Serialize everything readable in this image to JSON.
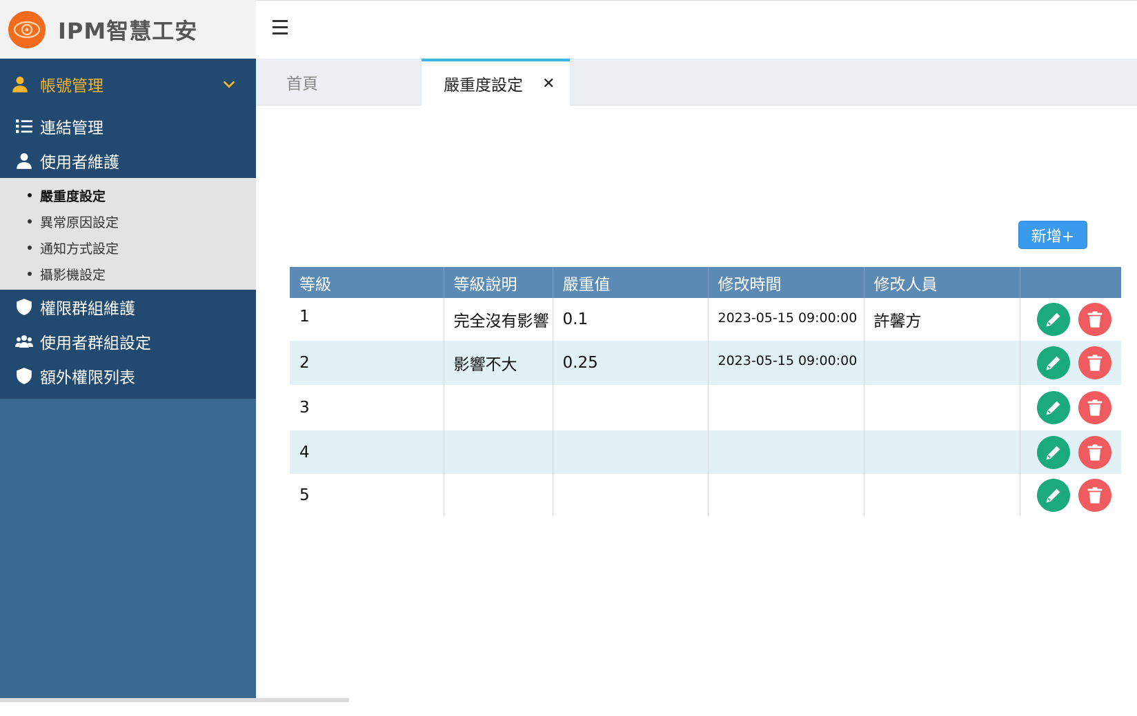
{
  "brand": {
    "title": "IPM智慧工安"
  },
  "sidebar": {
    "group_title": "帳號管理",
    "items_top": [
      {
        "label": "連結管理",
        "icon": "list-icon"
      },
      {
        "label": "使用者維護",
        "icon": "user-icon"
      }
    ],
    "sub_items": [
      {
        "label": "嚴重度設定",
        "active": true
      },
      {
        "label": "異常原因設定"
      },
      {
        "label": "通知方式設定"
      },
      {
        "label": "攝影機設定"
      }
    ],
    "items_bottom": [
      {
        "label": "權限群組維護",
        "icon": "shield-icon"
      },
      {
        "label": "使用者群組設定",
        "icon": "users-icon"
      },
      {
        "label": "額外權限列表",
        "icon": "shield-icon"
      }
    ]
  },
  "tabs": {
    "home": "首頁",
    "active": "嚴重度設定",
    "close": "✕"
  },
  "toolbar": {
    "add_label": "新增+"
  },
  "table": {
    "headers": [
      "等級",
      "等級說明",
      "嚴重值",
      "修改時間",
      "修改人員",
      ""
    ],
    "rows": [
      {
        "level": "1",
        "desc": "完全沒有影響",
        "value": "0.1",
        "time": "2023-05-15 09:00:00",
        "user": "許馨方"
      },
      {
        "level": "2",
        "desc": "影響不大",
        "value": "0.25",
        "time": "2023-05-15 09:00:00",
        "user": ""
      },
      {
        "level": "3",
        "desc": "",
        "value": "",
        "time": "",
        "user": ""
      },
      {
        "level": "4",
        "desc": "",
        "value": "",
        "time": "",
        "user": ""
      },
      {
        "level": "5",
        "desc": "",
        "value": "",
        "time": "",
        "user": ""
      }
    ]
  },
  "colors": {
    "sidebar_dark": "#224a70",
    "sidebar_light": "#3a6a92",
    "accent_orange": "#f5b52a",
    "header_blue": "#5b8ab5",
    "edit_green": "#1aaa7e",
    "delete_red": "#ef5b5f",
    "add_blue": "#3a9bee"
  }
}
